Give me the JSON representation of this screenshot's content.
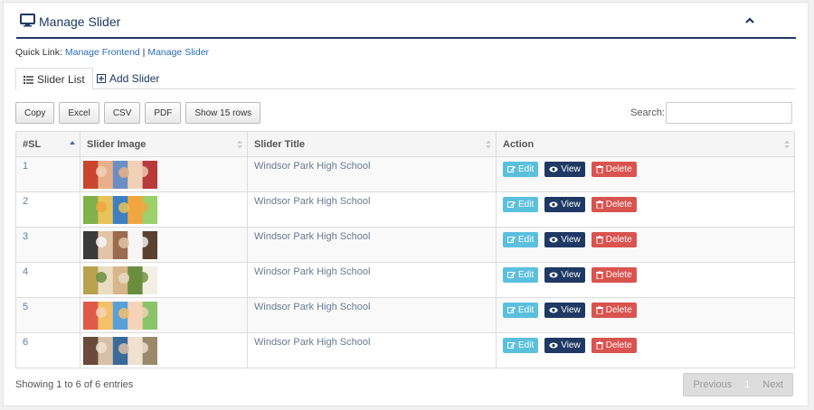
{
  "header": {
    "title": "Manage Slider",
    "icon": "monitor-icon",
    "collapse_icon": "chevron-up-icon",
    "accent": "#1f3864"
  },
  "quick_link": {
    "label": "Quick Link:",
    "link1": "Manage Frontend",
    "separator": "|",
    "link2": "Manage Slider"
  },
  "tabs": [
    {
      "label": "Slider List",
      "icon": "list-icon"
    },
    {
      "label": "Add Slider",
      "icon": "plus-square-icon"
    }
  ],
  "export_buttons": [
    "Copy",
    "Excel",
    "CSV",
    "PDF",
    "Show 15 rows"
  ],
  "search": {
    "label": "Search:",
    "value": ""
  },
  "table": {
    "columns": [
      "#SL",
      "Slider Image",
      "Slider Title",
      "Action"
    ],
    "rows": [
      {
        "sl": "1",
        "title": "Windsor Park High School"
      },
      {
        "sl": "2",
        "title": "Windsor Park High School"
      },
      {
        "sl": "3",
        "title": "Windsor Park High School"
      },
      {
        "sl": "4",
        "title": "Windsor Park High School"
      },
      {
        "sl": "5",
        "title": "Windsor Park High School"
      },
      {
        "sl": "6",
        "title": "Windsor Park High School"
      }
    ],
    "actions": {
      "edit": "Edit",
      "view": "View",
      "delete": "Delete"
    }
  },
  "footer": {
    "info": "Showing 1 to 6 of 6 entries",
    "prev": "Previous",
    "page": "1",
    "next": "Next"
  }
}
